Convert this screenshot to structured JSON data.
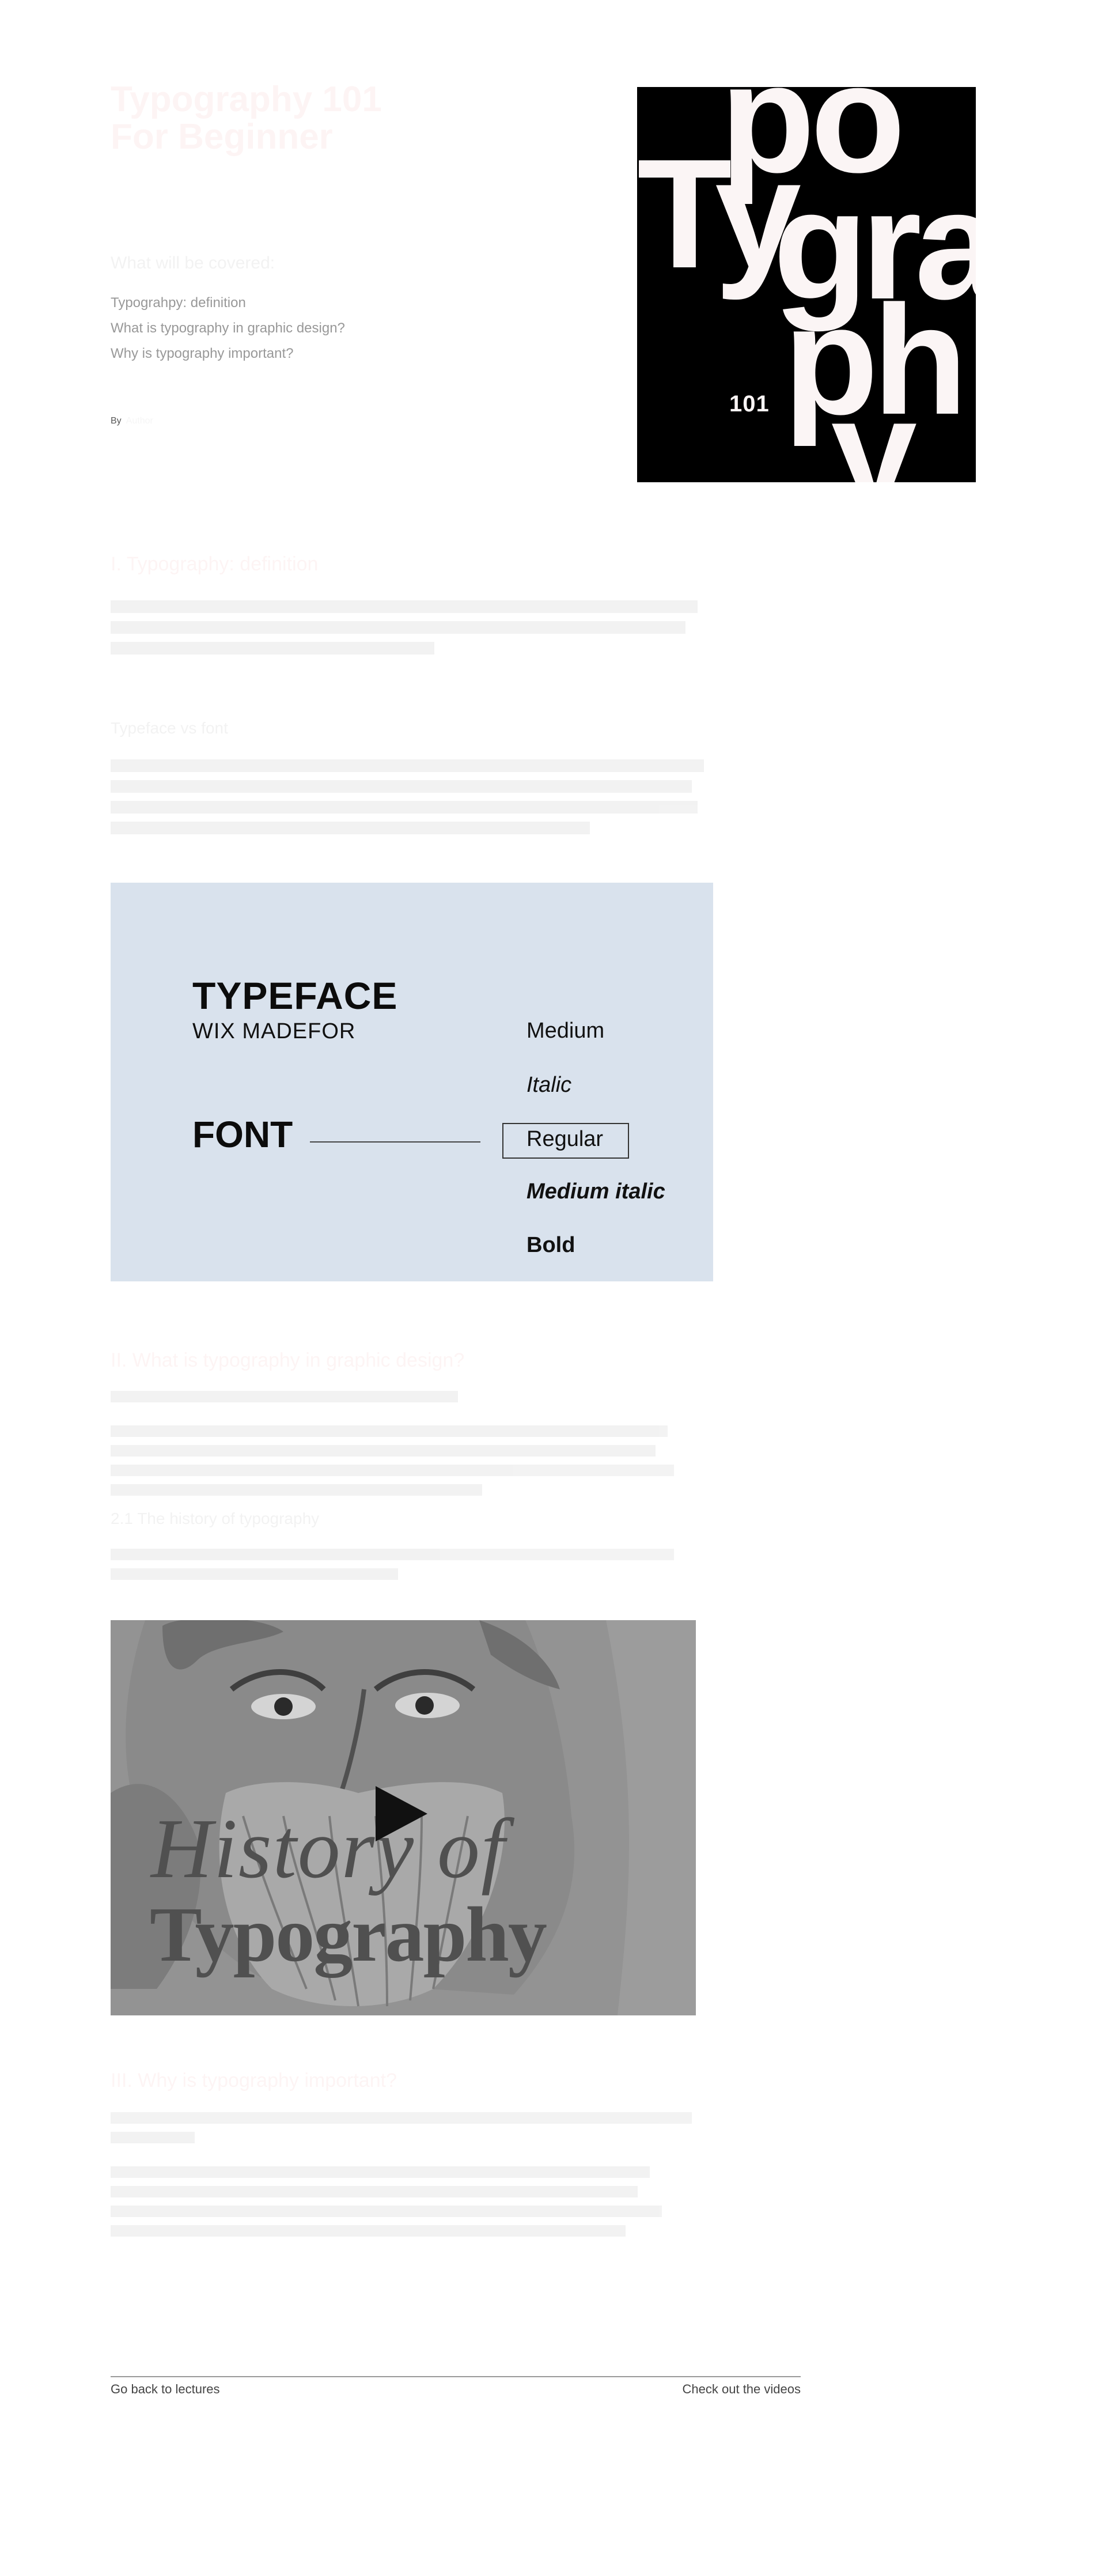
{
  "header": {
    "title_line1": "Typography 101",
    "title_line2": "For Beginner",
    "covered_heading": "What will be covered:",
    "covered_items": [
      "Typograhpy: definition",
      "What is typography in graphic design?",
      "Why is typography important?"
    ],
    "byline_prefix": "By",
    "byline_name": "Author"
  },
  "poster": {
    "line1": "po",
    "line2a": "Ty",
    "line2b": "gra",
    "line3": "ph",
    "line4": "y",
    "number": "101"
  },
  "section1": {
    "heading": "I. Typography: definition",
    "subheading": "Typeface vs font"
  },
  "type_diagram": {
    "typeface_label": "TYPEFACE",
    "typeface_name": "WIX MADEFOR",
    "font_label": "FONT",
    "weights": [
      "Medium",
      "Italic",
      "Regular",
      "Medium italic",
      "Bold"
    ]
  },
  "section2": {
    "heading": "II. What is typography in graphic design?",
    "subheading": "2.1 The history of typography"
  },
  "video": {
    "title_line1": "History of",
    "title_line2": "Typography",
    "play_icon": "play-icon"
  },
  "section3": {
    "heading": "III. Why is typography important?"
  },
  "footer": {
    "back_label": "Go back to lectures",
    "videos_label": "Check out the videos"
  }
}
